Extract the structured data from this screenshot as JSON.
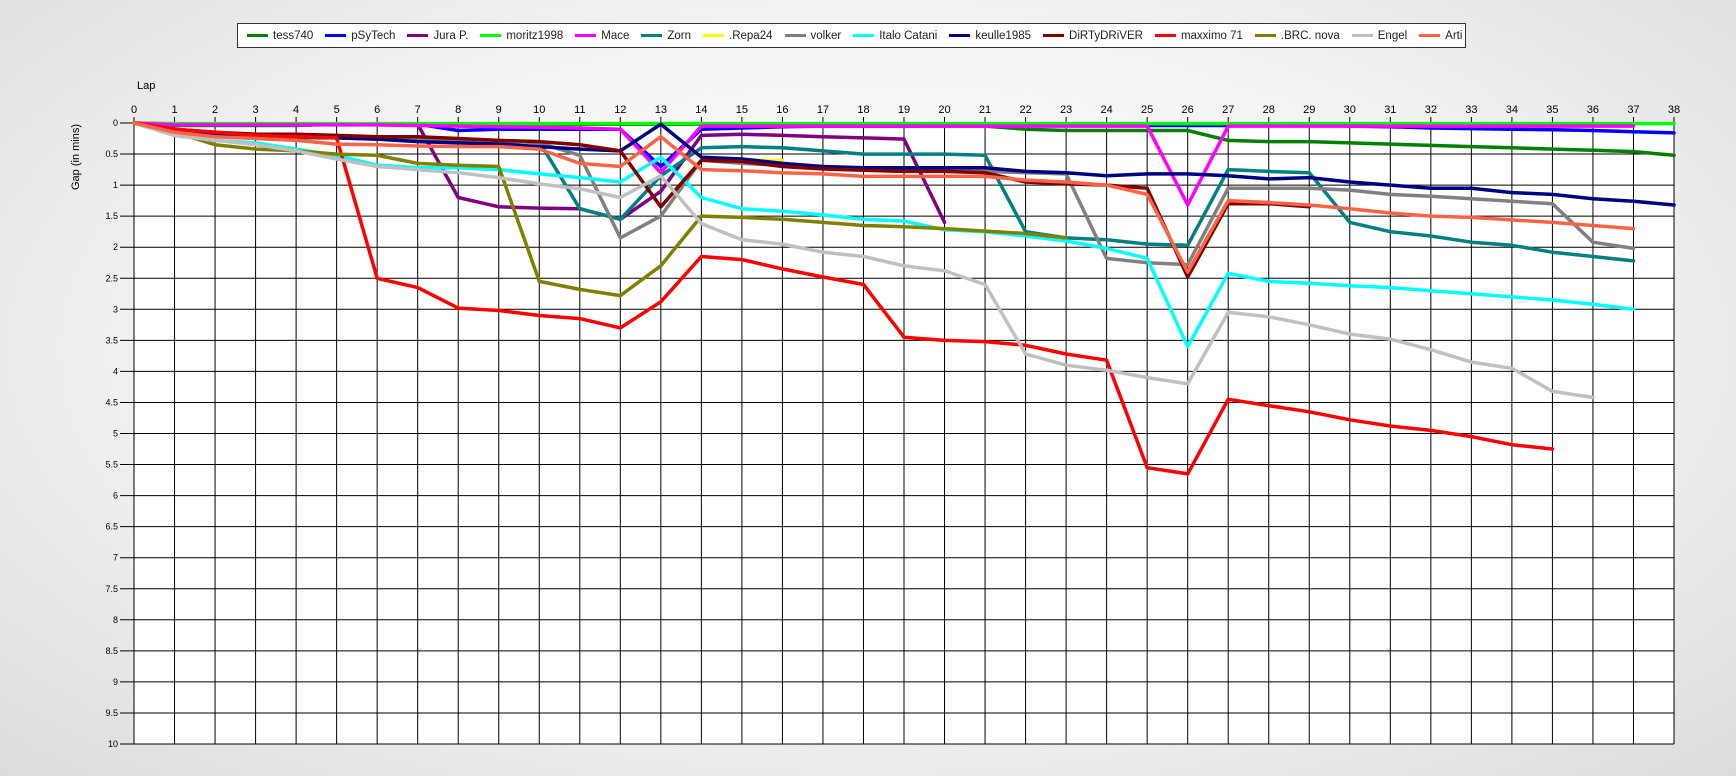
{
  "chart_data": {
    "type": "line",
    "xlabel": "Lap",
    "ylabel": "Gap (in mins)",
    "xlim": [
      0,
      38
    ],
    "ylim": [
      0,
      10
    ],
    "y_inverted": true,
    "x_ticks": [
      0,
      1,
      2,
      3,
      4,
      5,
      6,
      7,
      8,
      9,
      10,
      11,
      12,
      13,
      14,
      15,
      16,
      17,
      18,
      19,
      20,
      21,
      22,
      23,
      24,
      25,
      26,
      27,
      28,
      29,
      30,
      31,
      32,
      33,
      34,
      35,
      36,
      37,
      38
    ],
    "y_ticks": [
      "0",
      "0.5",
      "1",
      "1.5",
      "2",
      "2.5",
      "3",
      "3.5",
      "4",
      "4.5",
      "5",
      "5.5",
      "6",
      "6.5",
      "7",
      "7.5",
      "8",
      "8.5",
      "9",
      "9.5",
      "10"
    ],
    "grid": true,
    "legend_position": "top",
    "series": [
      {
        "name": "tess740",
        "color": "#008000",
        "values": [
          0,
          0.04,
          0.04,
          0.04,
          0.04,
          0.02,
          0.02,
          0.02,
          0.02,
          0.02,
          0.02,
          0.02,
          0.02,
          0.02,
          0.02,
          0.02,
          0.02,
          0.02,
          0.05,
          0.05,
          0.05,
          0.05,
          0.1,
          0.12,
          0.12,
          0.12,
          0.12,
          0.28,
          0.3,
          0.3,
          0.32,
          0.34,
          0.36,
          0.38,
          0.4,
          0.42,
          0.44,
          0.46,
          0.52
        ]
      },
      {
        "name": "pSyTech",
        "color": "#0000ff",
        "values": [
          0,
          0.02,
          0.02,
          0.02,
          0.02,
          0.02,
          0.02,
          0.02,
          0.12,
          0.1,
          0.1,
          0.1,
          0.1,
          0.7,
          0.1,
          0.08,
          0.06,
          0.05,
          0.05,
          0.05,
          0.04,
          0.04,
          0.04,
          0.04,
          0.04,
          0.04,
          0.04,
          0.04,
          0.03,
          0.03,
          0.05,
          0.06,
          0.08,
          0.09,
          0.1,
          0.11,
          0.12,
          0.14,
          0.16
        ]
      },
      {
        "name": "Jura P.",
        "color": "#800080",
        "values": [
          0,
          0.02,
          0.02,
          0.02,
          0.02,
          0.02,
          0.02,
          0.02,
          1.2,
          1.35,
          1.37,
          1.38,
          1.55,
          1.1,
          0.2,
          0.18,
          0.2,
          0.22,
          0.24,
          0.26,
          1.6
        ]
      },
      {
        "name": "moritz1998",
        "color": "#00ff00",
        "values": [
          0,
          0.01,
          0.01,
          0.01,
          0.01,
          0.01,
          0.01,
          0.01,
          0.01,
          0.01,
          0.01,
          0.01,
          0.01,
          0.01,
          0.01,
          0.01,
          0.01,
          0.01,
          0.01,
          0.01,
          0.01,
          0.01,
          0.01,
          0.01,
          0.01,
          0.01,
          0.01,
          0.01,
          0.01,
          0.01,
          0.01,
          0.01,
          0.01,
          0.01,
          0.01,
          0.01,
          0.01,
          0.01,
          0.01
        ]
      },
      {
        "name": "Mace",
        "color": "#ff00ff",
        "values": [
          0,
          0.03,
          0.03,
          0.03,
          0.03,
          0.03,
          0.03,
          0.04,
          0.05,
          0.06,
          0.07,
          0.08,
          0.1,
          0.8,
          0.05,
          0.05,
          0.05,
          0.05,
          0.05,
          0.05,
          0.05,
          0.05,
          0.05,
          0.05,
          0.05,
          0.05,
          1.32,
          0.05,
          0.05,
          0.05,
          0.05,
          0.05,
          0.05,
          0.05,
          0.05,
          0.05,
          0.05,
          0.05
        ]
      },
      {
        "name": "Zorn",
        "color": "#008080",
        "values": [
          0,
          0.15,
          0.2,
          0.22,
          0.24,
          0.24,
          0.26,
          0.28,
          0.28,
          0.3,
          0.3,
          1.38,
          1.55,
          0.85,
          0.4,
          0.38,
          0.4,
          0.45,
          0.5,
          0.5,
          0.5,
          0.52,
          1.75,
          1.85,
          1.88,
          1.95,
          1.97,
          0.75,
          0.78,
          0.8,
          1.6,
          1.75,
          1.82,
          1.92,
          1.97,
          2.08,
          2.15,
          2.22
        ]
      },
      {
        "name": ".Repa24",
        "color": "#ffff00",
        "values": [
          null,
          null,
          null,
          null,
          null,
          null,
          null,
          null,
          null,
          null,
          null,
          null,
          null,
          null,
          0.6,
          0.6,
          0.6
        ]
      },
      {
        "name": "volker",
        "color": "#808080",
        "values": [
          0,
          0.12,
          0.17,
          0.2,
          0.22,
          0.22,
          0.24,
          0.26,
          0.28,
          0.28,
          0.32,
          0.52,
          1.85,
          1.5,
          0.6,
          0.65,
          0.68,
          0.72,
          0.74,
          0.75,
          0.76,
          0.78,
          0.8,
          0.82,
          2.18,
          2.25,
          2.28,
          1.05,
          1.05,
          1.05,
          1.08,
          1.15,
          1.18,
          1.22,
          1.26,
          1.3,
          1.92,
          2.02
        ]
      },
      {
        "name": "Italo Catani",
        "color": "#00ffff",
        "values": [
          0,
          0.2,
          0.28,
          0.32,
          0.42,
          0.52,
          0.68,
          0.72,
          0.72,
          0.75,
          0.82,
          0.88,
          0.95,
          0.55,
          1.2,
          1.38,
          1.42,
          1.48,
          1.55,
          1.58,
          1.72,
          1.75,
          1.82,
          1.9,
          2.02,
          2.18,
          3.6,
          2.42,
          2.55,
          2.58,
          2.62,
          2.65,
          2.7,
          2.75,
          2.8,
          2.85,
          2.92,
          3.0
        ]
      },
      {
        "name": "keulle1985",
        "color": "#000080",
        "values": [
          0,
          0.12,
          0.18,
          0.2,
          0.22,
          0.24,
          0.26,
          0.3,
          0.32,
          0.34,
          0.38,
          0.42,
          0.45,
          0.02,
          0.55,
          0.58,
          0.65,
          0.7,
          0.72,
          0.72,
          0.72,
          0.72,
          0.78,
          0.8,
          0.85,
          0.82,
          0.82,
          0.85,
          0.9,
          0.88,
          0.95,
          1.0,
          1.05,
          1.05,
          1.12,
          1.15,
          1.22,
          1.26,
          1.32
        ]
      },
      {
        "name": "DiRTyDRiVER",
        "color": "#800000",
        "values": [
          0,
          0.1,
          0.15,
          0.18,
          0.18,
          0.2,
          0.22,
          0.22,
          0.25,
          0.28,
          0.3,
          0.35,
          0.45,
          1.35,
          0.6,
          0.62,
          0.7,
          0.74,
          0.76,
          0.78,
          0.78,
          0.8,
          0.95,
          0.98,
          1.0,
          1.05,
          2.48,
          1.3,
          1.3,
          1.35
        ]
      },
      {
        "name": "maxximo 71",
        "color": "#ff0000",
        "values": [
          0,
          0.1,
          0.15,
          0.2,
          0.22,
          0.24,
          2.5,
          2.65,
          2.98,
          3.02,
          3.1,
          3.15,
          3.3,
          2.88,
          2.15,
          2.2,
          2.35,
          2.48,
          2.6,
          3.45,
          3.5,
          3.52,
          3.58,
          3.72,
          3.82,
          5.55,
          5.65,
          4.45,
          4.55,
          4.65,
          4.78,
          4.88,
          4.95,
          5.05,
          5.18,
          5.25
        ]
      },
      {
        "name": ".BRC. nova",
        "color": "#808000",
        "values": [
          0,
          0.15,
          0.35,
          0.42,
          0.45,
          0.5,
          0.52,
          0.65,
          0.68,
          0.7,
          2.55,
          2.68,
          2.78,
          2.3,
          1.5,
          1.52,
          1.55,
          1.6,
          1.65,
          1.67,
          1.7,
          1.74,
          1.78,
          1.85
        ]
      },
      {
        "name": "Engel",
        "color": "#c0c0c0",
        "values": [
          0,
          0.2,
          0.28,
          0.35,
          0.45,
          0.58,
          0.7,
          0.75,
          0.8,
          0.88,
          0.98,
          1.06,
          1.2,
          0.85,
          1.62,
          1.88,
          1.95,
          2.08,
          2.15,
          2.3,
          2.38,
          2.6,
          3.72,
          3.9,
          3.98,
          4.1,
          4.2,
          3.05,
          3.12,
          3.25,
          3.4,
          3.48,
          3.65,
          3.85,
          3.95,
          4.32,
          4.42
        ]
      },
      {
        "name": "Arti",
        "color": "#ff6347",
        "values": [
          0,
          0.15,
          0.22,
          0.25,
          0.28,
          0.34,
          0.35,
          0.37,
          0.38,
          0.38,
          0.42,
          0.65,
          0.7,
          0.22,
          0.75,
          0.77,
          0.8,
          0.82,
          0.86,
          0.86,
          0.86,
          0.86,
          0.92,
          0.95,
          1.0,
          1.15,
          2.4,
          1.25,
          1.28,
          1.32,
          1.38,
          1.45,
          1.5,
          1.52,
          1.56,
          1.6,
          1.65,
          1.7
        ]
      }
    ]
  }
}
